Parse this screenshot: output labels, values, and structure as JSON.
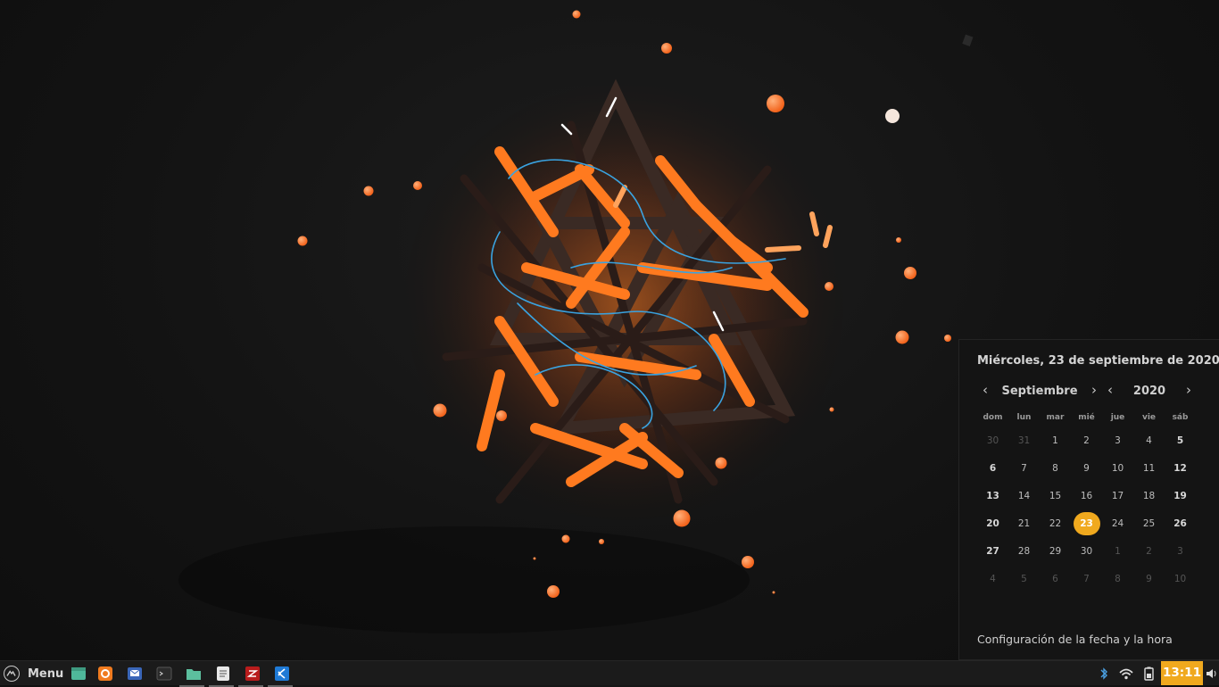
{
  "calendar": {
    "full_date": "Miércoles, 23 de septiembre de 2020",
    "month": "Septiembre",
    "year": "2020",
    "weekdays": [
      "dom",
      "lun",
      "mar",
      "mié",
      "jue",
      "vie",
      "sáb"
    ],
    "weeks": [
      [
        "30",
        "31",
        "1",
        "2",
        "3",
        "4",
        "5"
      ],
      [
        "6",
        "7",
        "8",
        "9",
        "10",
        "11",
        "12"
      ],
      [
        "13",
        "14",
        "15",
        "16",
        "17",
        "18",
        "19"
      ],
      [
        "20",
        "21",
        "22",
        "23",
        "24",
        "25",
        "26"
      ],
      [
        "27",
        "28",
        "29",
        "30",
        "1",
        "2",
        "3"
      ],
      [
        "4",
        "5",
        "6",
        "7",
        "8",
        "9",
        "10"
      ]
    ],
    "outside_days": [
      [
        0,
        0
      ],
      [
        0,
        1
      ],
      [
        4,
        4
      ],
      [
        4,
        5
      ],
      [
        4,
        6
      ],
      [
        5,
        0
      ],
      [
        5,
        1
      ],
      [
        5,
        2
      ],
      [
        5,
        3
      ],
      [
        5,
        4
      ],
      [
        5,
        5
      ],
      [
        5,
        6
      ]
    ],
    "today": [
      3,
      3
    ],
    "settings_link": "Configuración de la fecha y la hora",
    "prev_icon": "chevron-left-icon",
    "next_icon": "chevron-right-icon"
  },
  "taskbar": {
    "menu_label": "Menu",
    "menu_icon": "linux-mint-menu-icon",
    "launchers": [
      {
        "name": "show-desktop-icon"
      },
      {
        "name": "firefox-icon"
      },
      {
        "name": "mail-icon"
      },
      {
        "name": "terminal-icon"
      },
      {
        "name": "files-icon"
      },
      {
        "name": "text-editor-icon"
      },
      {
        "name": "filezilla-icon"
      },
      {
        "name": "vscode-icon"
      }
    ],
    "tray_icons": [
      "bluetooth-icon",
      "wifi-icon",
      "battery-icon"
    ],
    "clock": "13:11",
    "volume_icon": "volume-icon"
  },
  "colors": {
    "accent": "#f0a91e",
    "wallpaper_orange": "#ff7a1f",
    "wallpaper_blue": "#3aa3e0"
  }
}
